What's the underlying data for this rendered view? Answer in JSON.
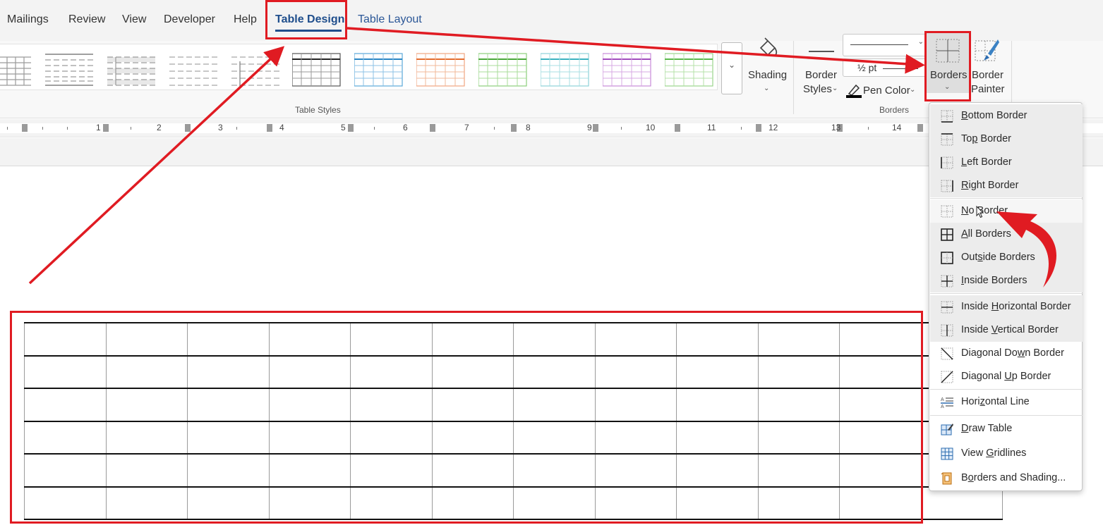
{
  "tabs": [
    {
      "label": "Mailings"
    },
    {
      "label": "Review"
    },
    {
      "label": "View"
    },
    {
      "label": "Developer"
    },
    {
      "label": "Help"
    },
    {
      "label": "Table Design"
    },
    {
      "label": "Table Layout"
    }
  ],
  "ribbon": {
    "table_styles_label": "Table Styles",
    "shading_label": "Shading",
    "border_styles_line1": "Border",
    "border_styles_line2": "Styles",
    "pen_weight": "½ pt",
    "pen_color_label": "Pen Color",
    "borders_group_label": "Borders",
    "borders_button_label": "Borders",
    "border_painter_line1": "Border",
    "border_painter_line2": "Painter",
    "pen_color_hex": "#000000"
  },
  "ruler": {
    "numbers": [
      "1",
      "2",
      "3",
      "4",
      "5",
      "6",
      "7",
      "8",
      "9",
      "10",
      "11",
      "12",
      "13",
      "14"
    ]
  },
  "borders_menu": {
    "items": [
      {
        "label": "Bottom Border",
        "accel": "B",
        "icon": "bottom-border-icon"
      },
      {
        "label": "Top Border",
        "accel": "p",
        "icon": "top-border-icon"
      },
      {
        "label": "Left Border",
        "accel": "L",
        "icon": "left-border-icon"
      },
      {
        "label": "Right Border",
        "accel": "R",
        "icon": "right-border-icon"
      },
      {
        "label": "No Border",
        "accel": "N",
        "icon": "no-border-icon"
      },
      {
        "label": "All Borders",
        "accel": "A",
        "icon": "all-borders-icon"
      },
      {
        "label": "Outside Borders",
        "accel": "S",
        "icon": "outside-borders-icon"
      },
      {
        "label": "Inside Borders",
        "accel": "I",
        "icon": "inside-borders-icon"
      },
      {
        "label": "Inside Horizontal Border",
        "accel": "H",
        "icon": "inside-horizontal-border-icon"
      },
      {
        "label": "Inside Vertical Border",
        "accel": "V",
        "icon": "inside-vertical-border-icon"
      },
      {
        "label": "Diagonal Down Border",
        "accel": "W",
        "icon": "diagonal-down-border-icon"
      },
      {
        "label": "Diagonal Up Border",
        "accel": "U",
        "icon": "diagonal-up-border-icon"
      },
      {
        "label": "Horizontal Line",
        "accel": "Z",
        "icon": "horizontal-line-icon"
      },
      {
        "label": "Draw Table",
        "accel": "D",
        "icon": "draw-table-icon"
      },
      {
        "label": "View Gridlines",
        "accel": "G",
        "icon": "view-gridlines-icon"
      },
      {
        "label": "Borders and Shading...",
        "accel": "O",
        "icon": "borders-and-shading-icon"
      }
    ]
  },
  "colors": {
    "annotation_red": "#e01b22",
    "active_tab": "#1f4e8c"
  }
}
